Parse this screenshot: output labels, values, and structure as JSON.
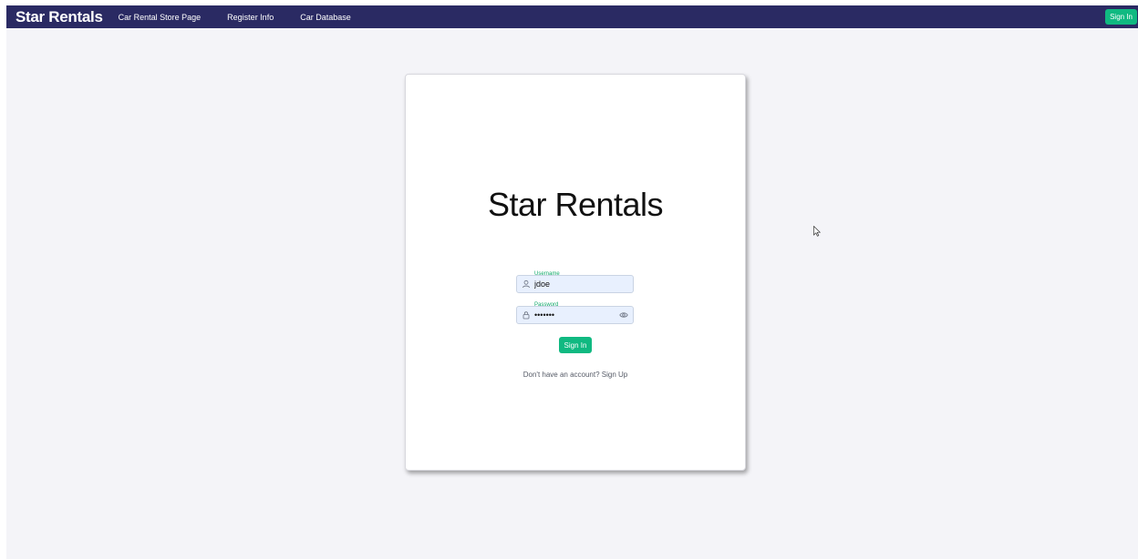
{
  "navbar": {
    "brand": "Star Rentals",
    "links": [
      "Car Rental Store Page",
      "Register Info",
      "Car Database"
    ],
    "signin_label": "Sign In"
  },
  "login": {
    "title": "Star Rentals",
    "username": {
      "label": "Username",
      "value": "jdoe"
    },
    "password": {
      "label": "Password",
      "value": "•••••••"
    },
    "submit_label": "Sign In",
    "signup_prompt": "Don't have an account?",
    "signup_link": "Sign Up"
  },
  "colors": {
    "navbar_bg": "#2a2a63",
    "accent": "#10b981",
    "field_bg": "#e8f0fe"
  }
}
